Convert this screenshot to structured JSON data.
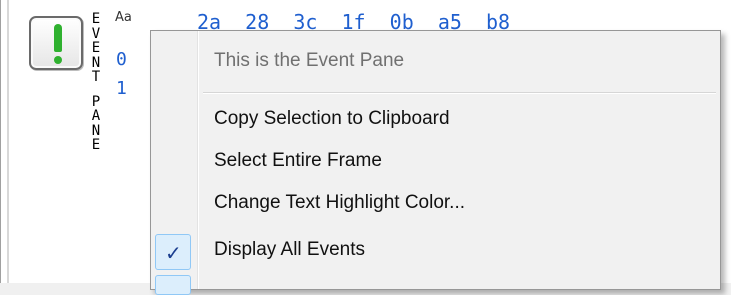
{
  "event_pane": {
    "vertical_label": [
      "E",
      "V",
      "E",
      "N",
      "T",
      "",
      "P",
      "A",
      "N",
      "E"
    ],
    "header_icon": "font-icon",
    "header_hex": "2a  28  3c  1f  0b  a5  b8",
    "rows": [
      {
        "num": "0"
      },
      {
        "num": "1"
      }
    ],
    "button_icon": "exclamation-icon",
    "button_color": "#2fb12f"
  },
  "context_menu": {
    "title": "This is the Event Pane",
    "items": [
      {
        "label": "Copy Selection to Clipboard"
      },
      {
        "label": "Select Entire Frame"
      },
      {
        "label": "Change Text Highlight Color..."
      },
      {
        "label": "Display All Events",
        "checked": true
      }
    ],
    "check_glyph": "✓"
  }
}
